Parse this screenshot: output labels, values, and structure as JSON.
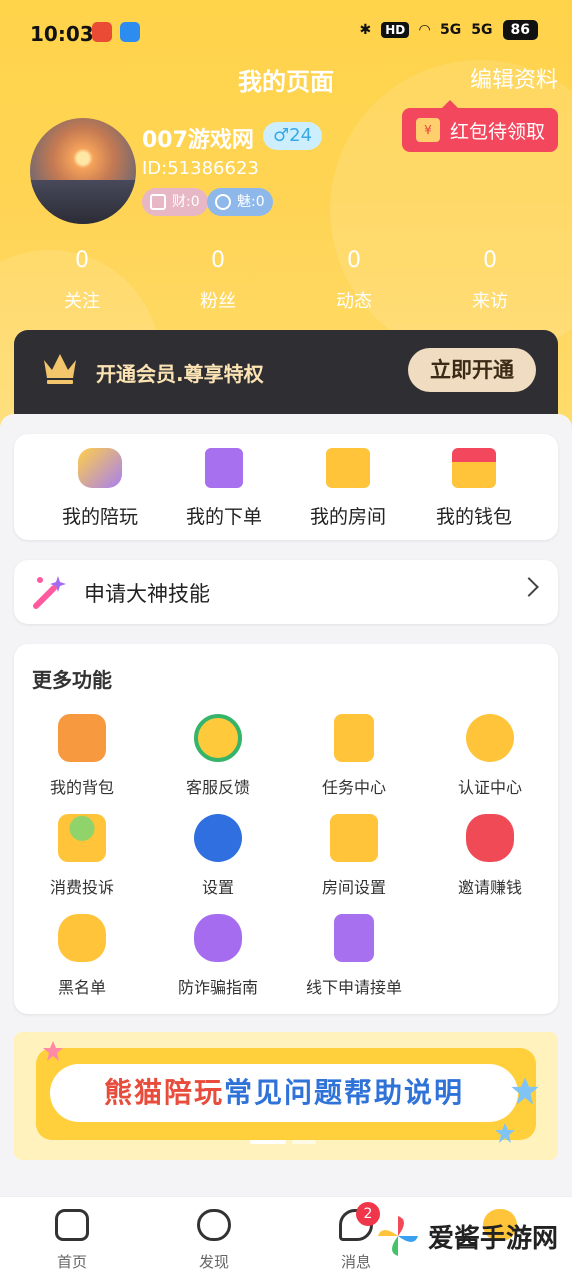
{
  "status_bar": {
    "time": "10:03",
    "hd": "HD",
    "net1": "5G",
    "net2": "5G",
    "battery": "86"
  },
  "header": {
    "title": "我的页面",
    "edit_label": "编辑资料",
    "red_packet_label": "红包待领取"
  },
  "profile": {
    "name": "007游戏网",
    "gender_age": "♂24",
    "id": "ID:51386623",
    "wealth": "财:0",
    "charm": "魅:0"
  },
  "stats": [
    {
      "value": "0",
      "label": "关注"
    },
    {
      "value": "0",
      "label": "粉丝"
    },
    {
      "value": "0",
      "label": "动态"
    },
    {
      "value": "0",
      "label": "来访"
    }
  ],
  "vip": {
    "text": "开通会员.尊享特权",
    "button": "立即开通"
  },
  "quick_actions": [
    {
      "label": "我的陪玩",
      "icon": "gamepad-icon"
    },
    {
      "label": "我的下单",
      "icon": "order-icon"
    },
    {
      "label": "我的房间",
      "icon": "room-icon"
    },
    {
      "label": "我的钱包",
      "icon": "wallet-icon"
    }
  ],
  "apply": {
    "label": "申请大神技能"
  },
  "more": {
    "title": "更多功能",
    "items": [
      {
        "label": "我的背包",
        "icon": "backpack-icon"
      },
      {
        "label": "客服反馈",
        "icon": "support-icon"
      },
      {
        "label": "任务中心",
        "icon": "task-icon"
      },
      {
        "label": "认证中心",
        "icon": "certify-icon"
      },
      {
        "label": "消费投诉",
        "icon": "complaint-icon"
      },
      {
        "label": "设置",
        "icon": "settings-icon"
      },
      {
        "label": "房间设置",
        "icon": "room-settings-icon"
      },
      {
        "label": "邀请赚钱",
        "icon": "invite-money-icon"
      },
      {
        "label": "黑名单",
        "icon": "blacklist-icon"
      },
      {
        "label": "防诈骗指南",
        "icon": "anti-fraud-icon"
      },
      {
        "label": "线下申请接单",
        "icon": "offline-apply-icon"
      }
    ]
  },
  "banner": {
    "part1": "熊猫陪玩",
    "part2": "常见问题帮助说明"
  },
  "tabbar": [
    {
      "label": "首页",
      "icon": "home-icon"
    },
    {
      "label": "发现",
      "icon": "discover-icon"
    },
    {
      "label": "消息",
      "icon": "message-icon",
      "badge": "2"
    },
    {
      "label": "",
      "icon": "profile-icon"
    }
  ],
  "watermark": {
    "text": "爱酱手游网"
  },
  "colors": {
    "header": "#ffd34a",
    "vip_bg": "#2f2f33",
    "accent_red": "#f2475d",
    "badge": "#f0364a"
  }
}
